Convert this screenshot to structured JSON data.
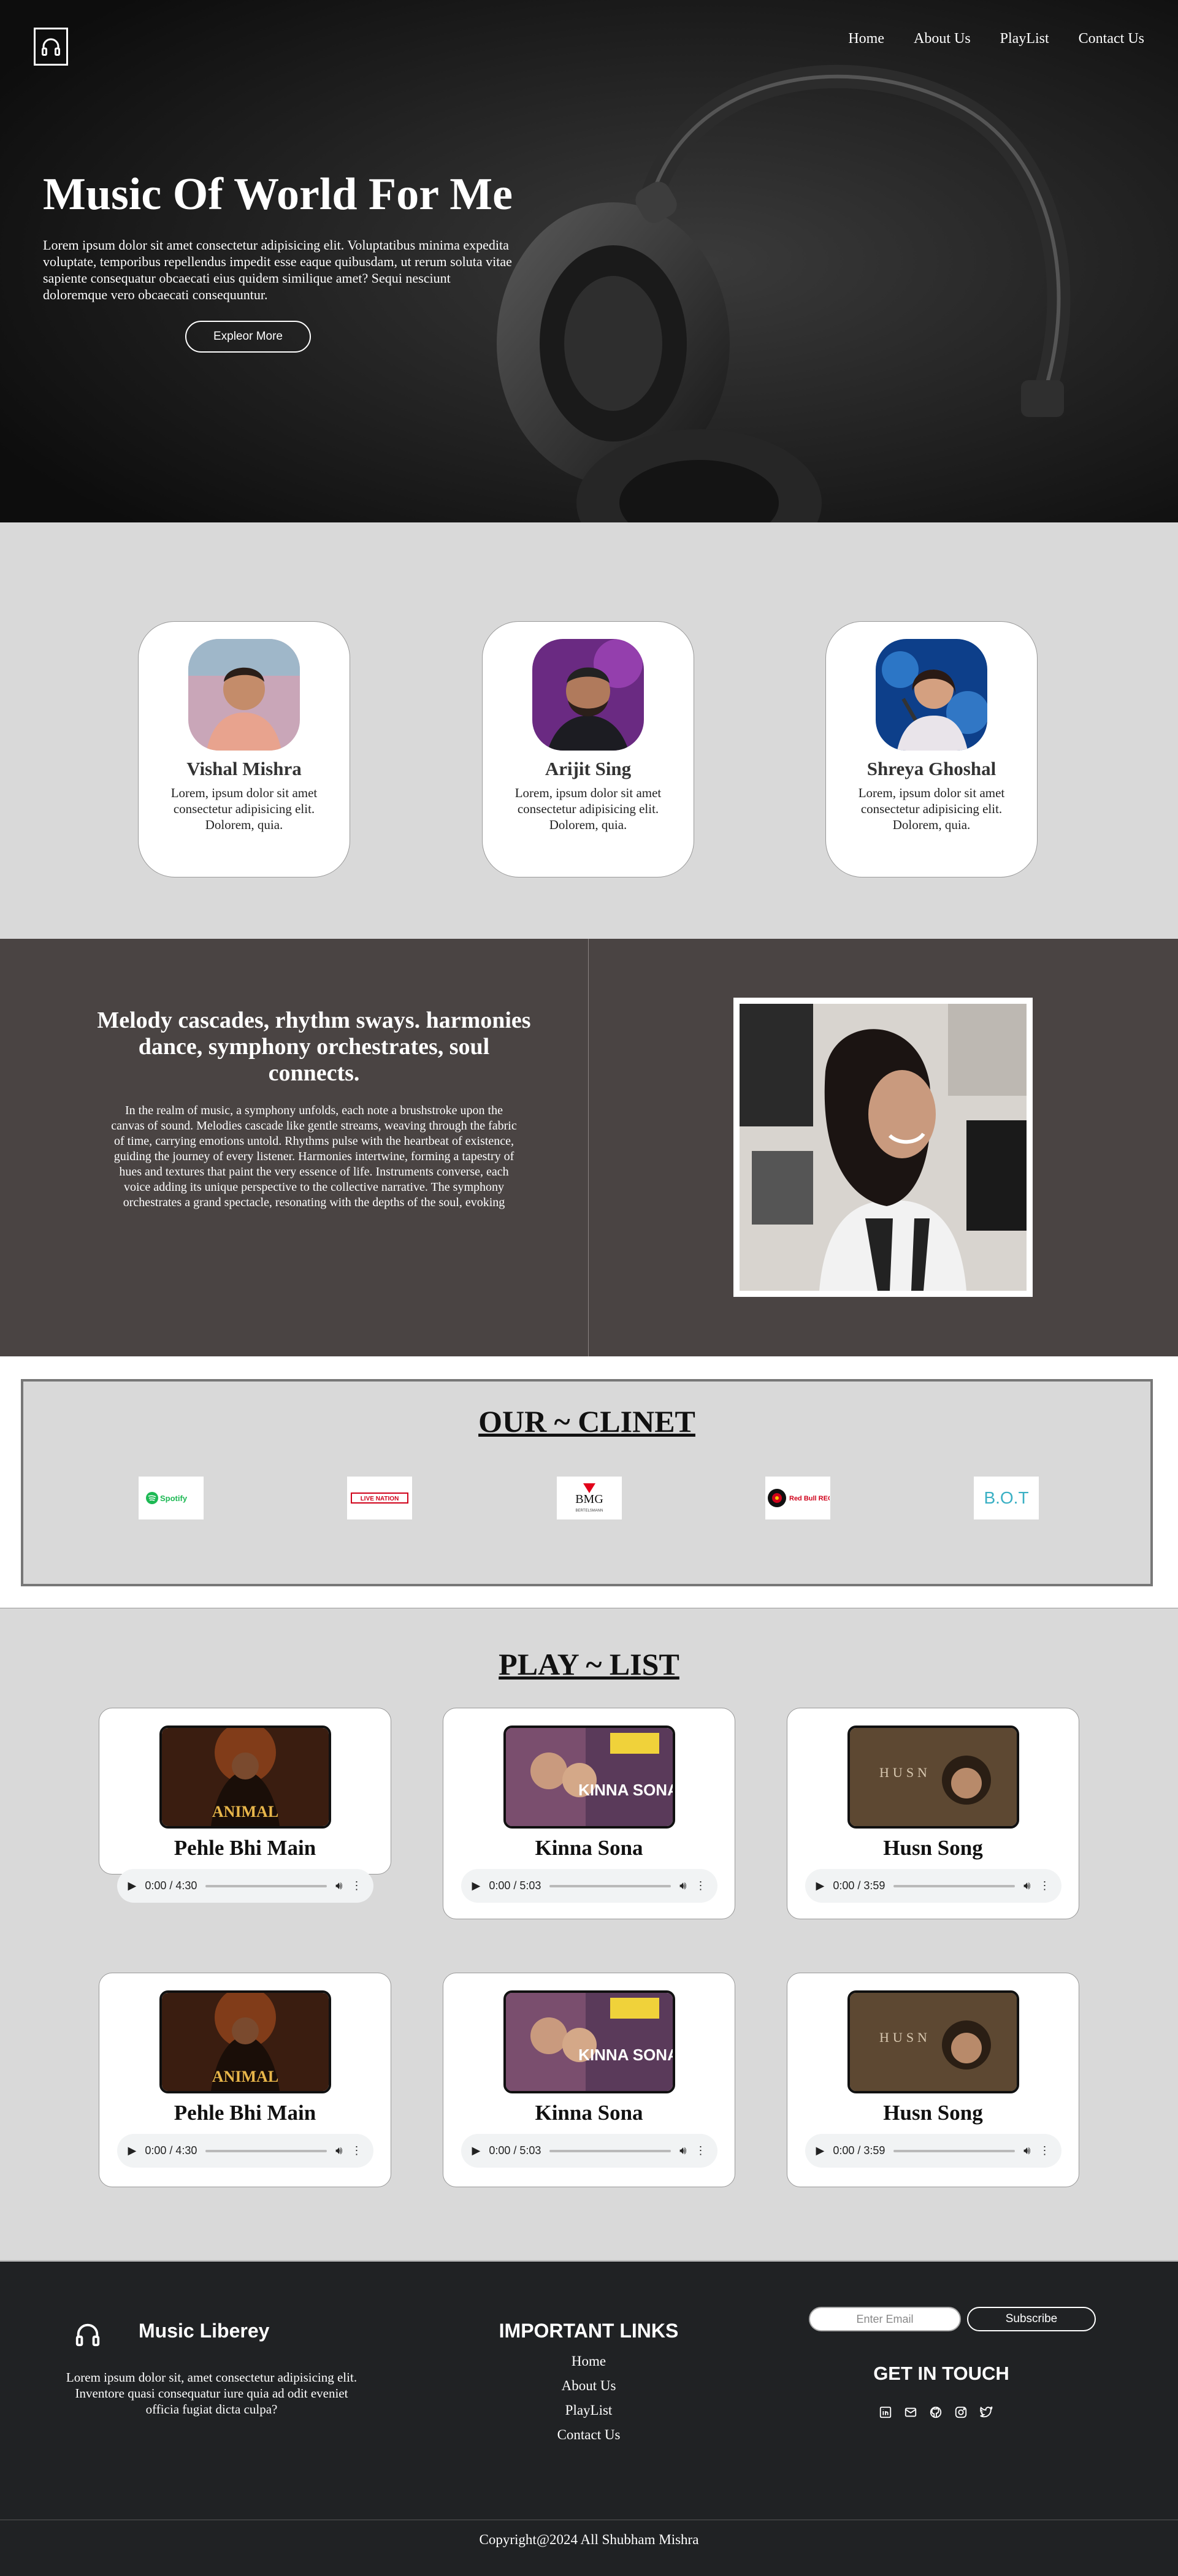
{
  "nav": {
    "items": [
      "Home",
      "About Us",
      "PlayList",
      "Contact Us"
    ]
  },
  "hero": {
    "title": "Music Of World For Me",
    "text": "Lorem ipsum dolor sit amet consectetur adipisicing elit. Voluptatibus minima expedita voluptate, temporibus repellendus impedit esse eaque quibusdam, ut rerum soluta vitae sapiente consequatur obcaecati eius quidem similique amet? Sequi nesciunt doloremque vero obcaecati consequuntur.",
    "button": "Expleor More"
  },
  "artists": [
    {
      "name": "Vishal Mishra",
      "desc": "Lorem, ipsum dolor sit amet consectetur adipisicing elit. Dolorem, quia."
    },
    {
      "name": "Arijit Sing",
      "desc": "Lorem, ipsum dolor sit amet consectetur adipisicing elit. Dolorem, quia."
    },
    {
      "name": "Shreya Ghoshal",
      "desc": "Lorem, ipsum dolor sit amet consectetur adipisicing elit. Dolorem, quia."
    }
  ],
  "melody": {
    "title": "Melody cascades, rhythm sways. harmonies dance, symphony orchestrates, soul connects.",
    "text": "In the realm of music, a symphony unfolds, each note a brushstroke upon the canvas of sound. Melodies cascade like gentle streams, weaving through the fabric of time, carrying emotions untold. Rhythms pulse with the heartbeat of existence, guiding the journey of every listener. Harmonies intertwine, forming a tapestry of hues and textures that paint the very essence of life. Instruments converse, each voice adding its unique perspective to the collective narrative. The symphony orchestrates a grand spectacle, resonating with the depths of the soul, evoking"
  },
  "clients": {
    "title": "OUR ~ CLINET",
    "logos": [
      "Spotify",
      "LIVE NATION",
      "BMG",
      "Red Bull RECORDS",
      "B.O.T"
    ],
    "bmg_sub": "BERTELSMANN"
  },
  "playlist": {
    "title": "PLAY ~ LIST",
    "songs": [
      {
        "title": "Pehle Bhi Main",
        "time": "0:00 / 4:30",
        "cover_text": "ANIMAL"
      },
      {
        "title": "Kinna Sona",
        "time": "0:00 / 5:03",
        "cover_text": "KINNA SONA"
      },
      {
        "title": "Husn Song",
        "time": "0:00 / 3:59",
        "cover_text": "HUSN"
      },
      {
        "title": "Pehle Bhi Main",
        "time": "0:00 / 4:30",
        "cover_text": "ANIMAL"
      },
      {
        "title": "Kinna Sona",
        "time": "0:00 / 5:03",
        "cover_text": "KINNA SONA"
      },
      {
        "title": "Husn Song",
        "time": "0:00 / 3:59",
        "cover_text": "HUSN"
      }
    ]
  },
  "footer": {
    "brand": "Music Liberey",
    "desc": "Lorem ipsum dolor sit, amet consectetur adipisicing elit. Inventore quasi consequatur iure quia ad odit eveniet officia fugiat dicta culpa?",
    "links_title": "IMPORTANT LINKS",
    "links": [
      "Home",
      "About Us",
      "PlayList",
      "Contact Us"
    ],
    "email_placeholder": "Enter Email",
    "subscribe": "Subscribe",
    "touch_title": "GET IN TOUCH",
    "socials": [
      "linkedin-icon",
      "mail-icon",
      "github-icon",
      "instagram-icon",
      "twitter-icon"
    ],
    "copyright": "Copyright@2024 All Shubham Mishra"
  },
  "colors": {
    "hero_bg": "#151515",
    "section_gray": "#d9d9d9",
    "melody_bg": "#4a4443",
    "footer_bg": "#202224"
  }
}
